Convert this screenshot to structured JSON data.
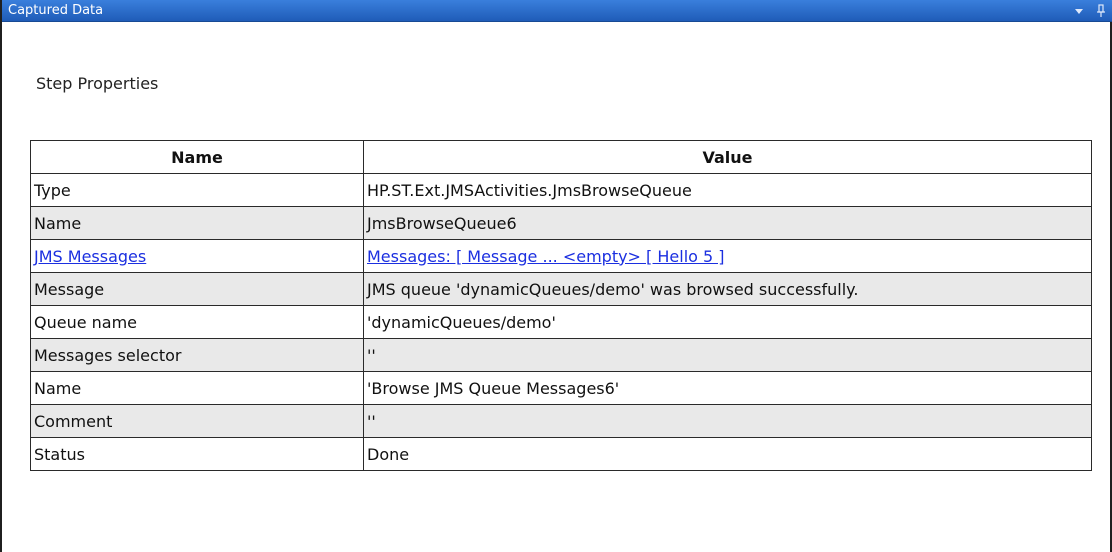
{
  "window": {
    "title": "Captured Data",
    "icons": [
      "dropdown-arrow-icon",
      "pin-icon"
    ]
  },
  "section": {
    "label": "Step Properties"
  },
  "table": {
    "headers": {
      "name": "Name",
      "value": "Value"
    },
    "rows": [
      {
        "name": "Type",
        "value": "HP.ST.Ext.JMSActivities.JmsBrowseQueue",
        "link": false
      },
      {
        "name": "Name",
        "value": "JmsBrowseQueue6",
        "link": false
      },
      {
        "name": "JMS Messages",
        "value": "Messages: [ Message  ... <empty> [ Hello 5 ]",
        "link": true
      },
      {
        "name": "Message",
        "value": "JMS queue 'dynamicQueues/demo' was browsed successfully.",
        "link": false
      },
      {
        "name": "Queue name",
        "value": "'dynamicQueues/demo'",
        "link": false
      },
      {
        "name": "Messages selector",
        "value": "''",
        "link": false
      },
      {
        "name": "Name",
        "value": "'Browse JMS Queue Messages6'",
        "link": false
      },
      {
        "name": "Comment",
        "value": "''",
        "link": false
      },
      {
        "name": "Status",
        "value": "Done",
        "link": false
      }
    ]
  },
  "colors": {
    "titlebar": "#2a6ccc",
    "link": "#1b2fe0",
    "alt_row": "#e9e9e9"
  }
}
